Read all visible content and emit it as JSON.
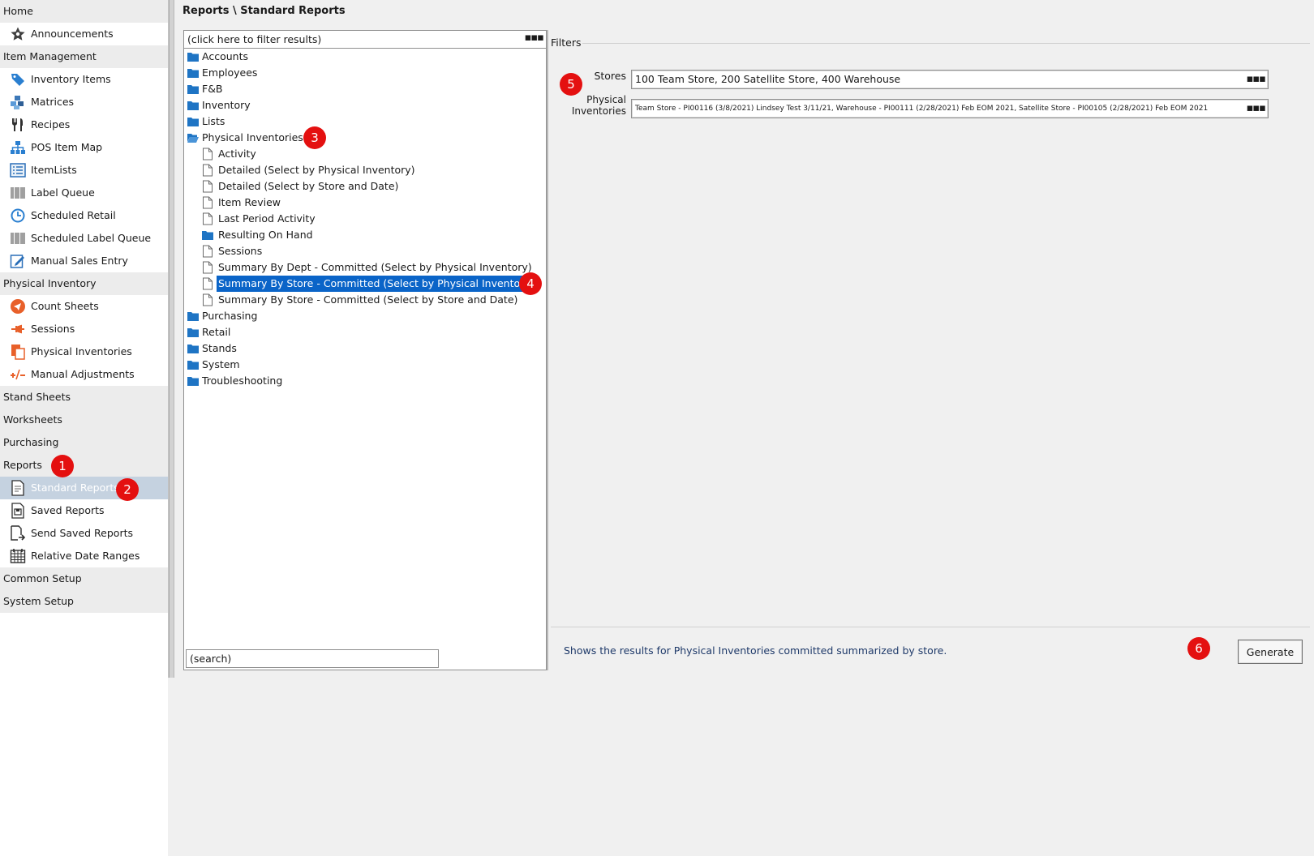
{
  "sidebar": {
    "home": "Home",
    "announcements": "Announcements",
    "item_management": "Item Management",
    "inventory_items": "Inventory Items",
    "matrices": "Matrices",
    "recipes": "Recipes",
    "pos_item_map": "POS Item Map",
    "itemlists": "ItemLists",
    "label_queue": "Label Queue",
    "scheduled_retail": "Scheduled Retail",
    "scheduled_label_queue": "Scheduled Label Queue",
    "manual_sales_entry": "Manual Sales Entry",
    "physical_inventory": "Physical Inventory",
    "count_sheets": "Count Sheets",
    "sessions": "Sessions",
    "physical_inventories": "Physical Inventories",
    "manual_adjustments": "Manual Adjustments",
    "stand_sheets": "Stand Sheets",
    "worksheets": "Worksheets",
    "purchasing": "Purchasing",
    "reports": "Reports",
    "standard_reports": "Standard Reports",
    "saved_reports": "Saved Reports",
    "send_saved_reports": "Send Saved Reports",
    "relative_date_ranges": "Relative Date Ranges",
    "common_setup": "Common Setup",
    "system_setup": "System Setup"
  },
  "main": {
    "title": "Reports \\ Standard Reports",
    "filter_placeholder": "(click here to filter results)",
    "dots": "▪▪▪",
    "search_value": "(search)",
    "tree": {
      "accounts": "Accounts",
      "employees": "Employees",
      "fb": "F&B",
      "inventory": "Inventory",
      "lists": "Lists",
      "physical_inventories": "Physical Inventories",
      "activity": "Activity",
      "detailed_pi": "Detailed (Select by Physical Inventory)",
      "detailed_store_date": "Detailed (Select by Store and Date)",
      "item_review": "Item Review",
      "last_period_activity": "Last Period Activity",
      "resulting_on_hand": "Resulting On Hand",
      "sessions": "Sessions",
      "summary_dept_pi": "Summary By Dept - Committed (Select by Physical Inventory)",
      "summary_store_pi": "Summary By Store - Committed (Select by Physical Inventory)",
      "summary_store_date": "Summary By Store - Committed (Select by Store and Date)",
      "purchasing": "Purchasing",
      "retail": "Retail",
      "stands": "Stands",
      "system": "System",
      "troubleshooting": "Troubleshooting"
    }
  },
  "filters": {
    "heading": "Filters",
    "stores_label": "Stores",
    "stores_value": "100 Team Store, 200 Satellite Store, 400 Warehouse",
    "pi_label_1": "Physical",
    "pi_label_2": "Inventories",
    "pi_value": "Team Store - PI00116 (3/8/2021) Lindsey Test 3/11/21, Warehouse - PI00111 (2/28/2021) Feb EOM 2021, Satellite Store - PI00105 (2/28/2021) Feb EOM 2021"
  },
  "footer": {
    "description": "Shows the results for Physical Inventories committed summarized by store.",
    "generate_label": "Generate"
  },
  "badges": {
    "b1": "1",
    "b2": "2",
    "b3": "3",
    "b4": "4",
    "b5": "5",
    "b6": "6"
  },
  "colors": {
    "selection_blue": "#0a64c8",
    "sidebar_selected": "#c5d2e0",
    "folder_blue": "#1e74c4",
    "badge_red": "#e41010"
  }
}
